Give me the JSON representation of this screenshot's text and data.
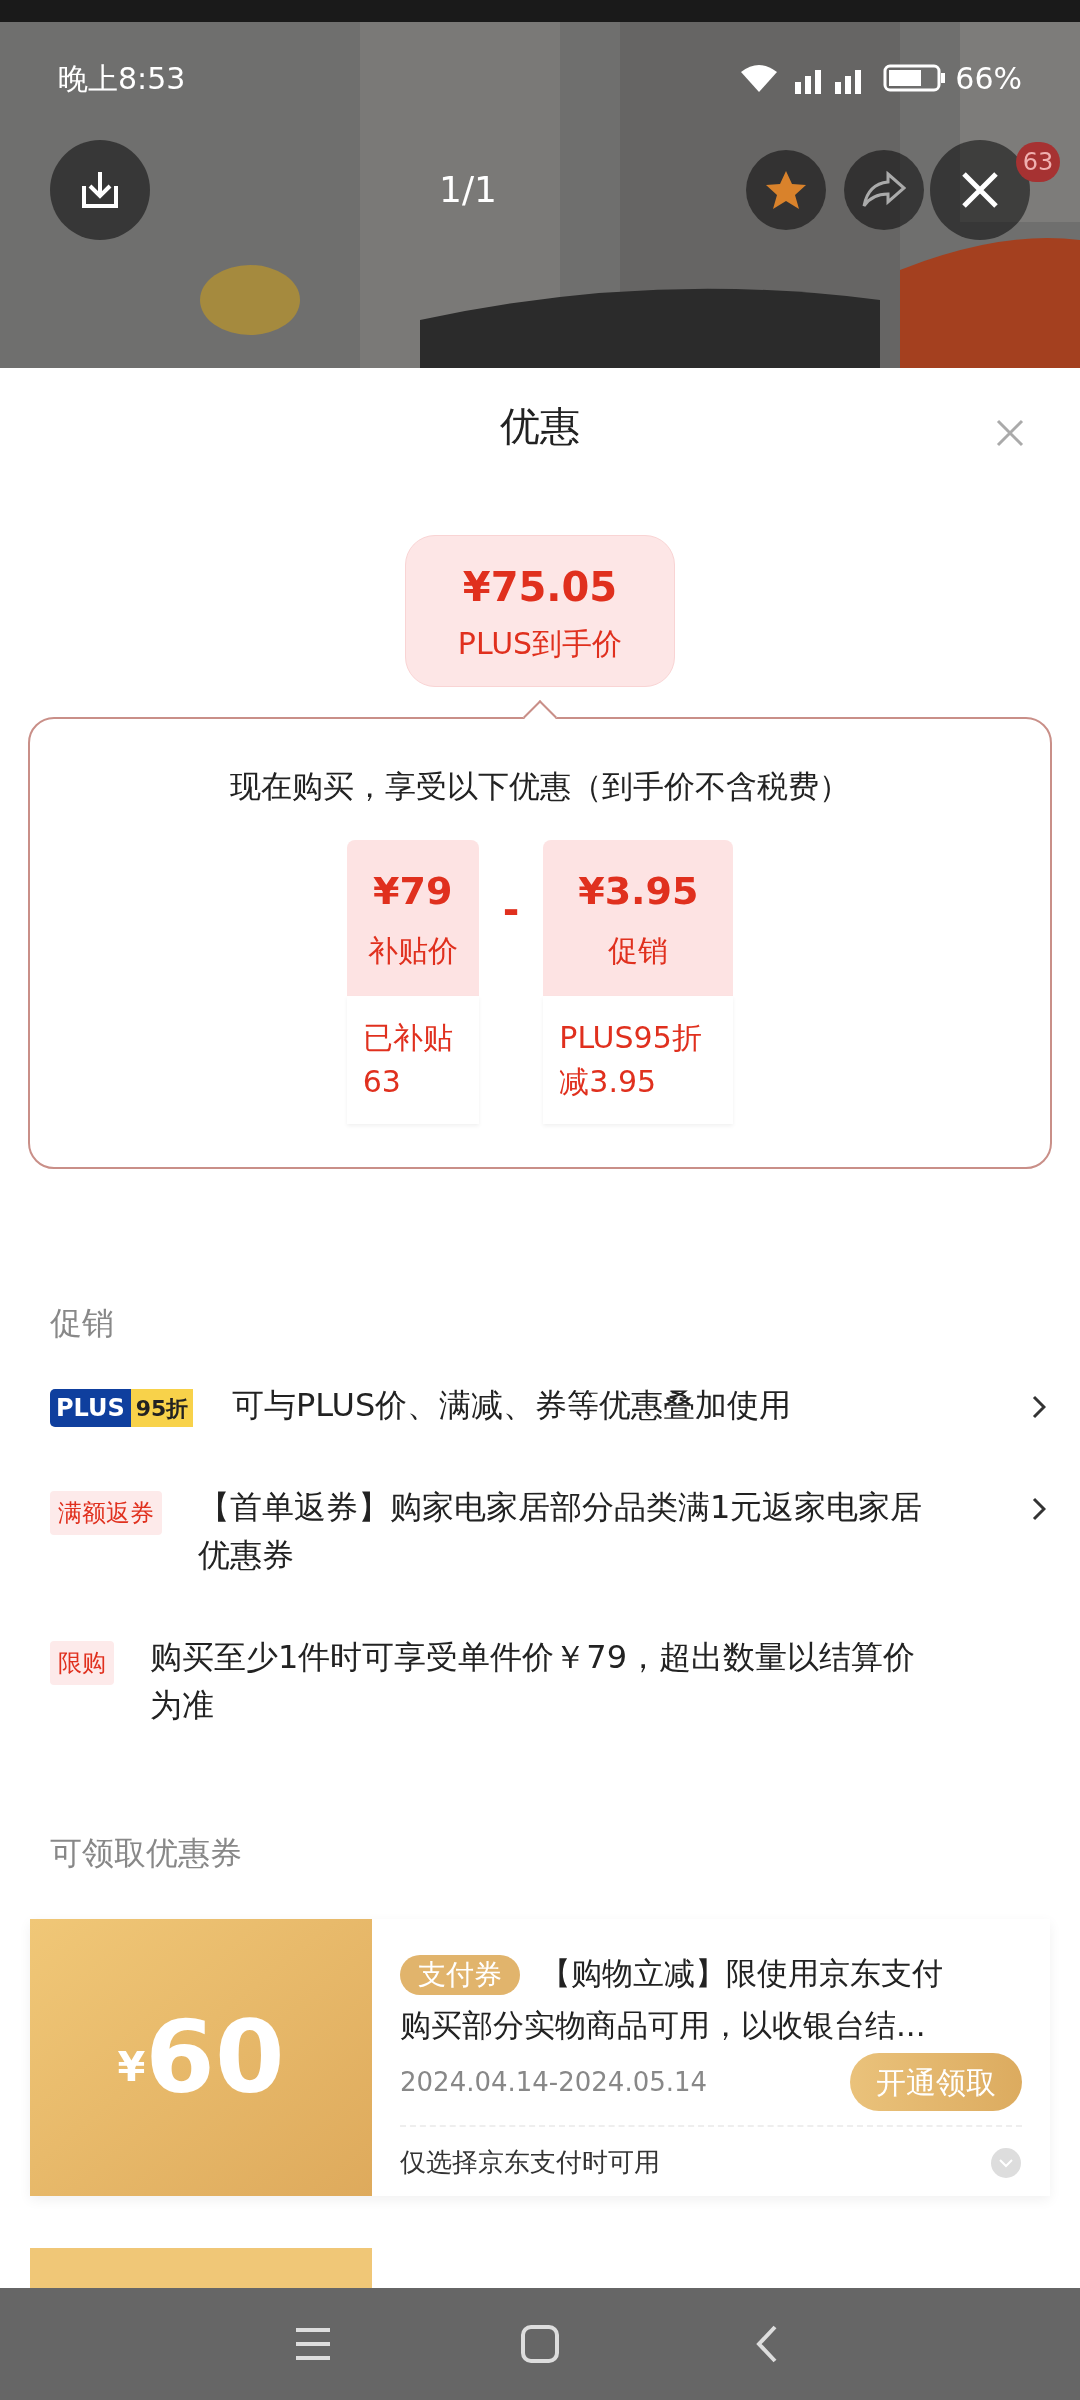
{
  "status_bar": {
    "time": "晚上8:53",
    "battery": "66%"
  },
  "viewer": {
    "counter": "1/1",
    "badge": "63"
  },
  "sheet": {
    "title": "优惠",
    "price": {
      "amount": "¥75.05",
      "label": "PLUS到手价"
    },
    "breakdown": {
      "heading": "现在购买，享受以下优惠（到手价不含税费）",
      "operator": "-",
      "items": [
        {
          "amount": "¥79",
          "label": "补贴价",
          "detail": "已补贴63"
        },
        {
          "amount": "¥3.95",
          "label": "促销",
          "detail": "PLUS95折减3.95"
        }
      ]
    },
    "promotions": {
      "title": "促销",
      "items": [
        {
          "kind": "plus",
          "tag": "PLUS",
          "tag_extra": "95折",
          "text": "可与PLUS价、满减、券等优惠叠加使用",
          "arrow": true
        },
        {
          "kind": "tag",
          "tag": "满额返券",
          "text": "【首单返券】购家电家居部分品类满1元返家电家居优惠券",
          "arrow": true
        },
        {
          "kind": "tag",
          "tag": "限购",
          "text": "购买至少1件时可享受单件价￥79，超出数量以结算价为准",
          "arrow": false
        }
      ]
    },
    "coupons": {
      "title": "可领取优惠券",
      "items": [
        {
          "currency": "¥",
          "value": "60",
          "tag": "支付券",
          "text": "【购物立减】限使用京东支付购买部分实物商品可用，以收银台结...",
          "dates": "2024.04.14-2024.05.14",
          "button": "开通领取",
          "note": "仅选择京东支付时可用"
        }
      ]
    }
  }
}
